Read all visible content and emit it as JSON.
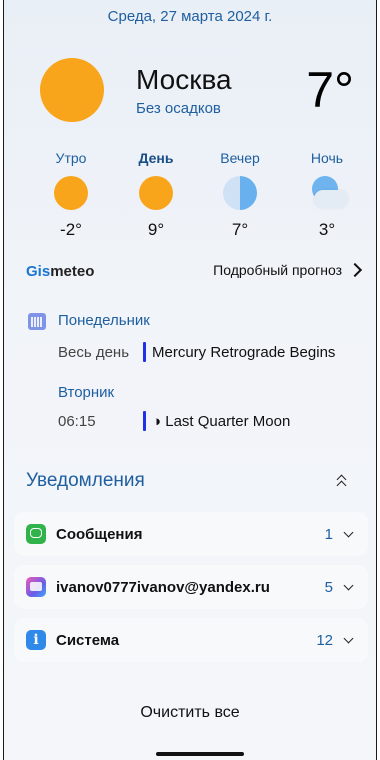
{
  "header": {
    "date": "Среда, 27 марта 2024 г."
  },
  "weather": {
    "city": "Москва",
    "condition": "Без осадков",
    "temp_now": "7°",
    "periods": [
      {
        "label": "Утро",
        "icon": "sun-icon",
        "temp": "-2°"
      },
      {
        "label": "День",
        "icon": "sun-icon",
        "temp": "9°"
      },
      {
        "label": "Вечер",
        "icon": "moon-icon",
        "temp": "7°"
      },
      {
        "label": "Ночь",
        "icon": "cloud-icon",
        "temp": "3°"
      }
    ],
    "provider_prefix": "Gis",
    "provider_suffix": "meteo",
    "forecast_link": "Подробный прогноз"
  },
  "calendar": {
    "days": [
      {
        "day": "Понедельник",
        "time": "Весь день",
        "title": "Mercury Retrograde Begins"
      },
      {
        "day": "Вторник",
        "time": "06:15",
        "title": "◑ Last Quarter Moon"
      }
    ]
  },
  "notifications": {
    "title": "Уведомления",
    "groups": [
      {
        "name": "Сообщения",
        "count": "1",
        "icon": "messages-app-icon"
      },
      {
        "name": "ivanov0777ivanov@yandex.ru",
        "count": "5",
        "icon": "mail-app-icon"
      },
      {
        "name": "Система",
        "count": "12",
        "icon": "system-info-icon"
      }
    ],
    "clear_all": "Очистить все"
  },
  "colors": {
    "accent": "#1f5fa0",
    "sun": "#f9a51b",
    "event_bar": "#1e30e8"
  }
}
